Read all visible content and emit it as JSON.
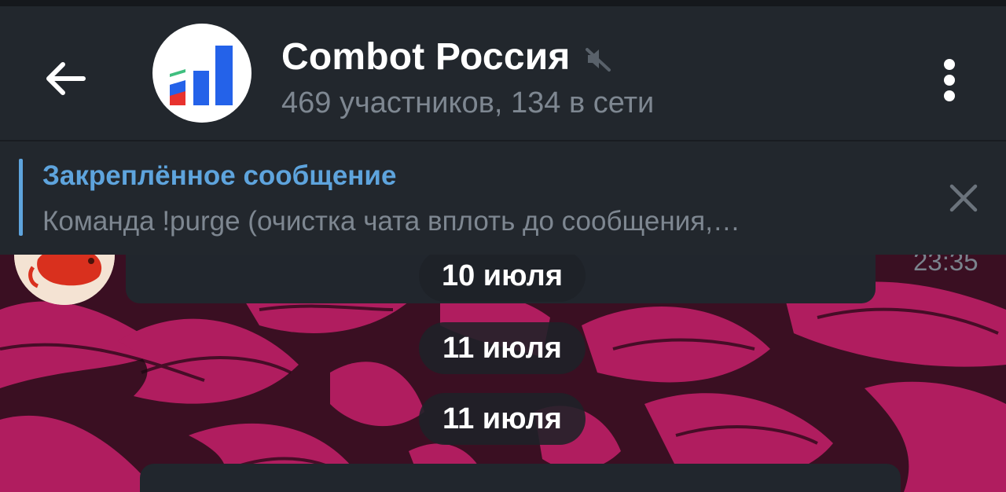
{
  "header": {
    "title": "Combot Россия",
    "subtitle": "469 участников, 134 в сети",
    "icons": {
      "back": "arrow-left-icon",
      "mute": "muted-speaker-icon",
      "menu": "more-vertical-icon"
    }
  },
  "pinned": {
    "title": "Закреплённое сообщение",
    "text": "Команда !purge (очистка чата вплоть до сообщения,…",
    "accent_color": "#5ea4dd"
  },
  "messages": {
    "partial_message_time": "23:35",
    "dates": [
      "10 июля",
      "11 июля",
      "11 июля"
    ]
  },
  "colors": {
    "header_bg": "#22272d",
    "wallpaper_base": "#3a0f22",
    "wallpaper_pattern": "#b01d5f",
    "bubble_bg": "#21262d"
  }
}
